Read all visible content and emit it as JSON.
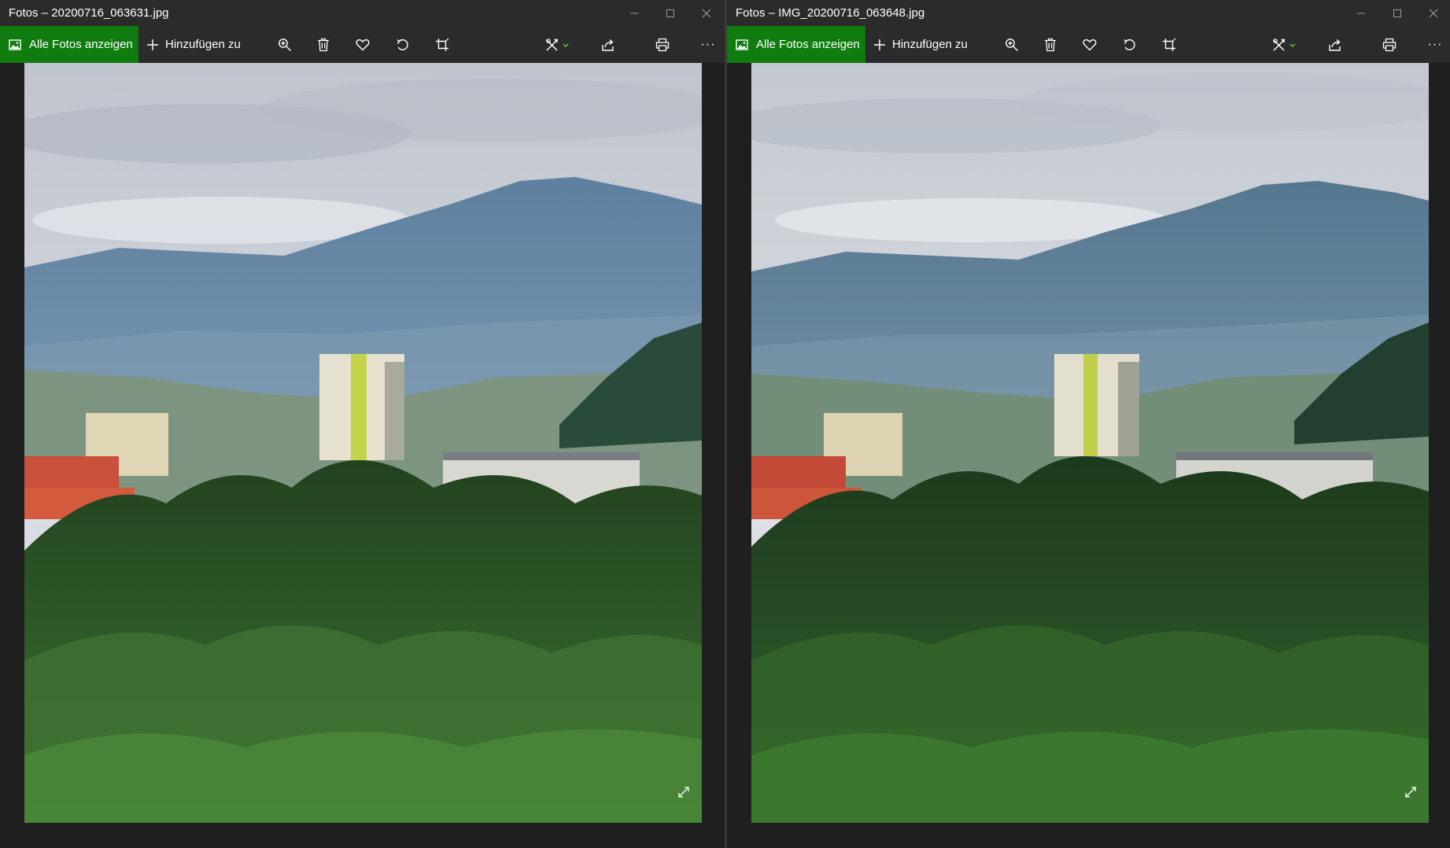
{
  "windows": [
    {
      "title": "Fotos – 20200716_063631.jpg",
      "toolbar": {
        "all_photos_label": "Alle Fotos anzeigen",
        "add_to_label": "Hinzufügen zu",
        "more_label": "···"
      }
    },
    {
      "title": "Fotos – IMG_20200716_063648.jpg",
      "toolbar": {
        "all_photos_label": "Alle Fotos anzeigen",
        "add_to_label": "Hinzufügen zu",
        "more_label": "···"
      }
    }
  ],
  "icons": {
    "photos_app": "photos-icon",
    "add": "plus-icon",
    "zoom": "zoom-in-icon",
    "delete": "trash-icon",
    "favorite": "heart-icon",
    "rotate": "rotate-icon",
    "crop": "crop-icon",
    "edit": "edit-create-icon",
    "share": "share-icon",
    "print": "print-icon",
    "expand": "expand-icon"
  },
  "colors": {
    "accent": "#107c10",
    "toolbar_bg": "#2b2b2b",
    "window_bg": "#1f1f1f",
    "text": "#ffffff"
  }
}
